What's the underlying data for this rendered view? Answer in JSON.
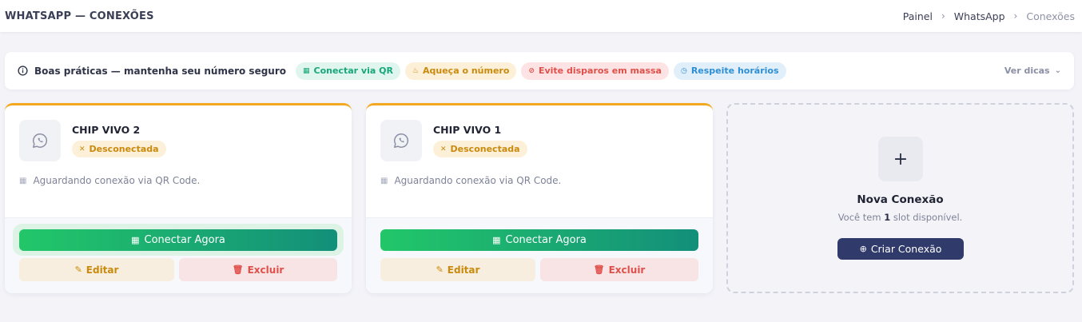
{
  "header": {
    "title": "WHATSAPP — CONEXÕES",
    "breadcrumb": [
      "Painel",
      "WhatsApp",
      "Conexões"
    ],
    "breadcrumb_separator": "›"
  },
  "tips": {
    "title": "Boas práticas — mantenha seu número seguro",
    "pills": [
      {
        "label": "Conectar via QR",
        "icon": "qr-icon",
        "color": "#18a77a"
      },
      {
        "label": "Aqueça o número",
        "icon": "flame-icon",
        "color": "#c98a0d"
      },
      {
        "label": "Evite disparos em massa",
        "icon": "alert-icon",
        "color": "#e0504a"
      },
      {
        "label": "Respeite horários",
        "icon": "clock-icon",
        "color": "#2f8fd3"
      }
    ],
    "toggle_label": "Ver dicas"
  },
  "connections": [
    {
      "name": "CHIP VIVO 2",
      "status": "Desconectada",
      "message": "Aguardando conexão via QR Code.",
      "connect_label": "Conectar Agora",
      "edit_label": "Editar",
      "delete_label": "Excluir"
    },
    {
      "name": "CHIP VIVO 1",
      "status": "Desconectada",
      "message": "Aguardando conexão via QR Code.",
      "connect_label": "Conectar Agora",
      "edit_label": "Editar",
      "delete_label": "Excluir"
    }
  ],
  "new_connection": {
    "plus": "+",
    "title": "Nova Conexão",
    "subtitle_prefix": "Você tem",
    "slots": "1",
    "subtitle_suffix": "slot disponível.",
    "button_label": "Criar Conexão"
  },
  "colors": {
    "accent_border": "#f3a91f",
    "connect_gradient_start": "#22c769",
    "connect_gradient_end": "#138f7a",
    "create_button": "#313b6b"
  }
}
